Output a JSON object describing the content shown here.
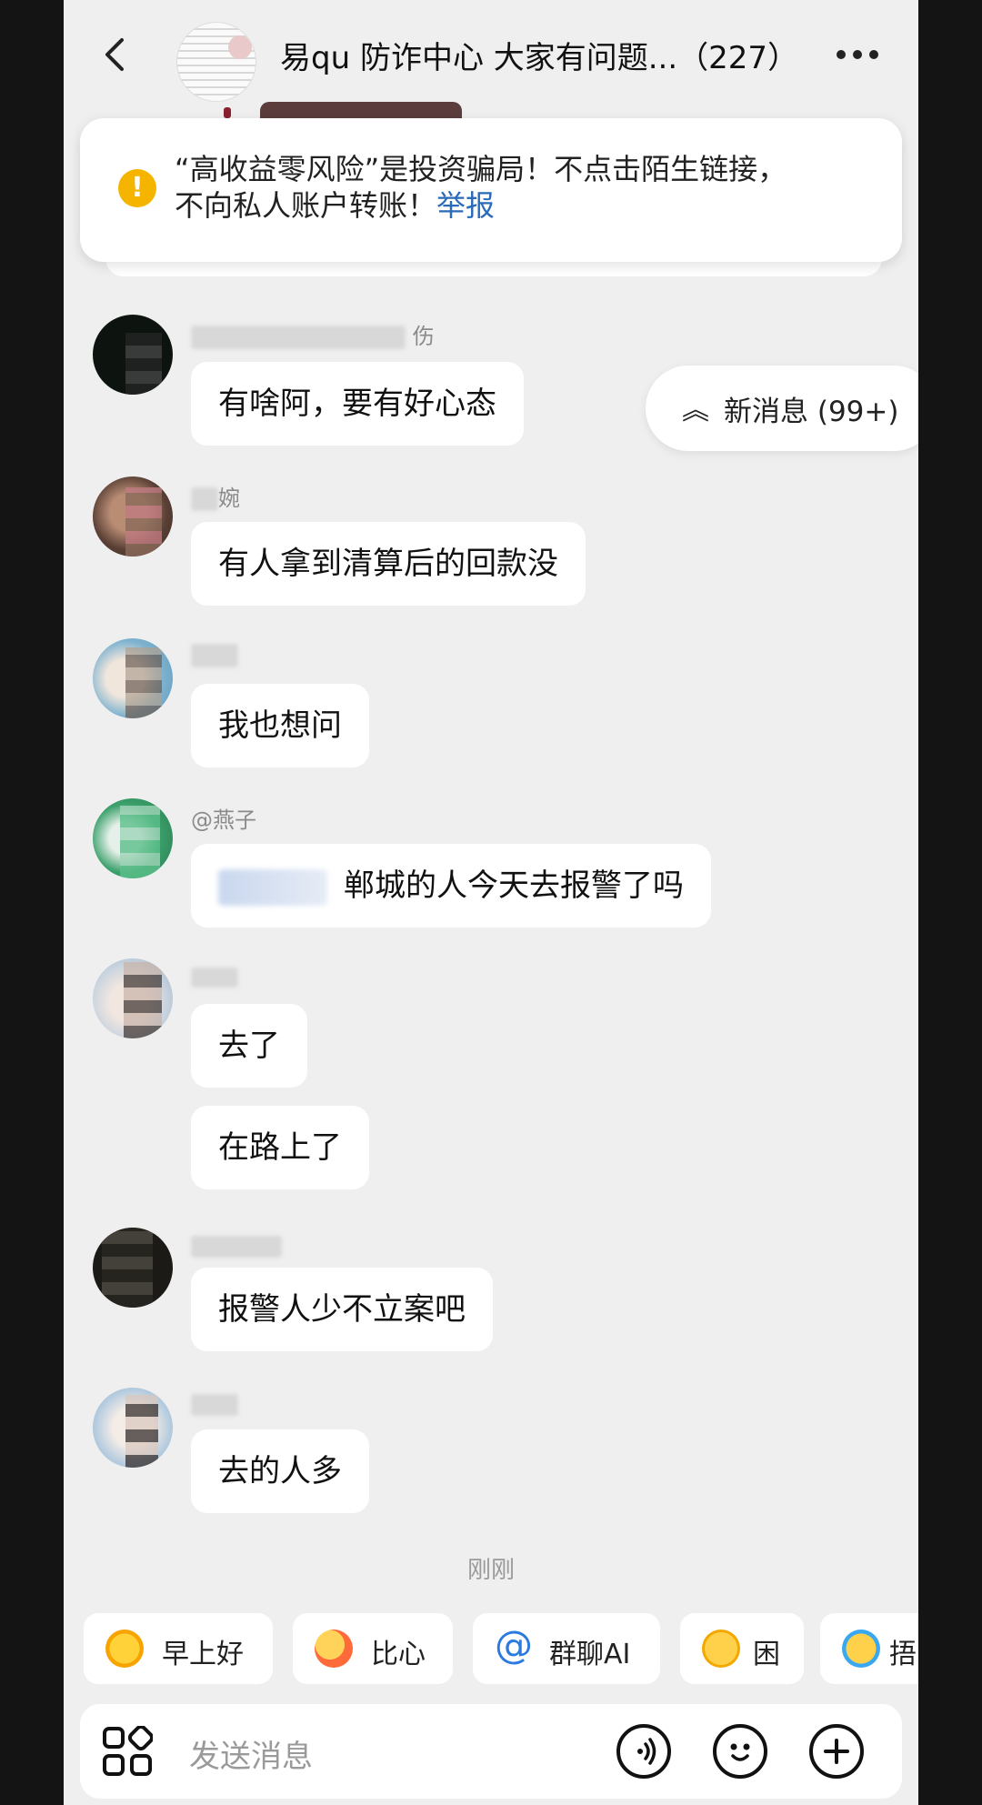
{
  "header": {
    "title": "易qu 防诈中心 大家有问题...（227）"
  },
  "banner": {
    "line1": "“高收益零风险”是投资骗局！不点击陌生链接，",
    "line2": "不向私人账户转账！",
    "report": "举报"
  },
  "new_messages": {
    "label": "新消息 (99+)"
  },
  "messages": [
    {
      "nick": "伤",
      "text": "有啥阿，要有好心态"
    },
    {
      "nick": "婉",
      "text": "有人拿到清算后的回款没"
    },
    {
      "nick": "",
      "text": "我也想问"
    },
    {
      "nick": "@燕子",
      "text": "郸城的人今天去报警了吗"
    },
    {
      "nick": "",
      "text": "去了"
    },
    {
      "nick": "",
      "text": "在路上了"
    },
    {
      "nick": "",
      "text": "报警人少不立案吧"
    },
    {
      "nick": "",
      "text": "去的人多"
    }
  ],
  "timestamp": "刚刚",
  "quick_replies": [
    {
      "label": "早上好",
      "icon": "sun-emoji-icon"
    },
    {
      "label": "比心",
      "icon": "heart-hand-emoji-icon"
    },
    {
      "label": "群聊AI",
      "icon": "at-icon"
    },
    {
      "label": "困",
      "icon": "sleepy-emoji-icon"
    },
    {
      "label": "捂",
      "icon": "laugh-cry-emoji-icon"
    }
  ],
  "input": {
    "placeholder": "发送消息"
  },
  "colors": {
    "background": "#efefef",
    "warning": "#f5b400",
    "link": "#2a6ab8",
    "bubble": "#ffffff"
  }
}
